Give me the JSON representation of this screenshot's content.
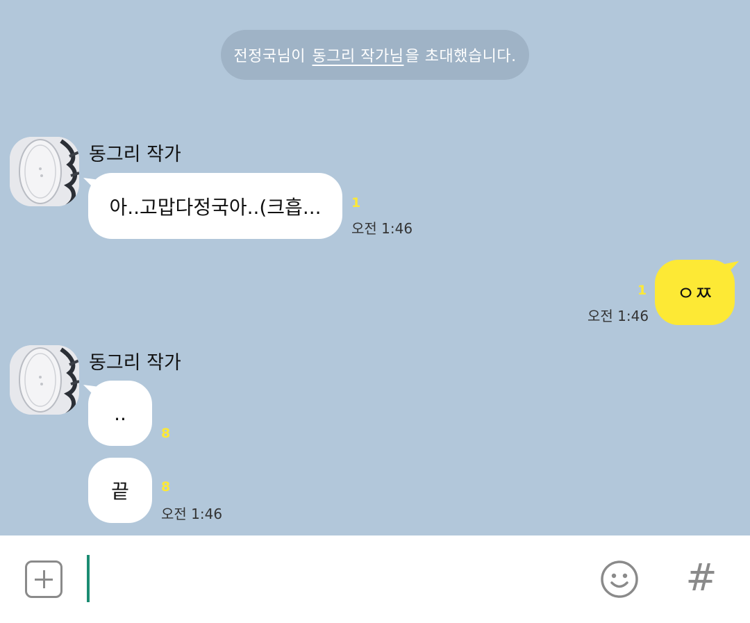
{
  "system_notice": {
    "prefix": "전정국님이",
    "invitee": "동그리 작가님",
    "suffix": "을 초대했습니다."
  },
  "messages": [
    {
      "sender": "동그리 작가",
      "bubbles": [
        {
          "text": "아..고맙다정국아..(크흡...",
          "unread": "1"
        }
      ],
      "time": "오전 1:46"
    },
    {
      "mine": true,
      "bubbles": [
        {
          "text": "ㅇㅉ",
          "unread": "1"
        }
      ],
      "time": "오전 1:46"
    },
    {
      "sender": "동그리 작가",
      "bubbles": [
        {
          "text": "..",
          "unread": "8"
        },
        {
          "text": "끝",
          "unread": "8"
        }
      ],
      "time": "오전 1:46"
    }
  ],
  "input_bar": {
    "placeholder": "",
    "icons": {
      "add": "plus-square-icon",
      "emoticon": "smiley-icon",
      "hashtag": "hash-icon"
    }
  },
  "colors": {
    "chat_background": "#b2c7da",
    "my_bubble": "#fde935",
    "other_bubble": "#ffffff",
    "unread_count": "#fde935",
    "cursor": "#1b8c72"
  }
}
